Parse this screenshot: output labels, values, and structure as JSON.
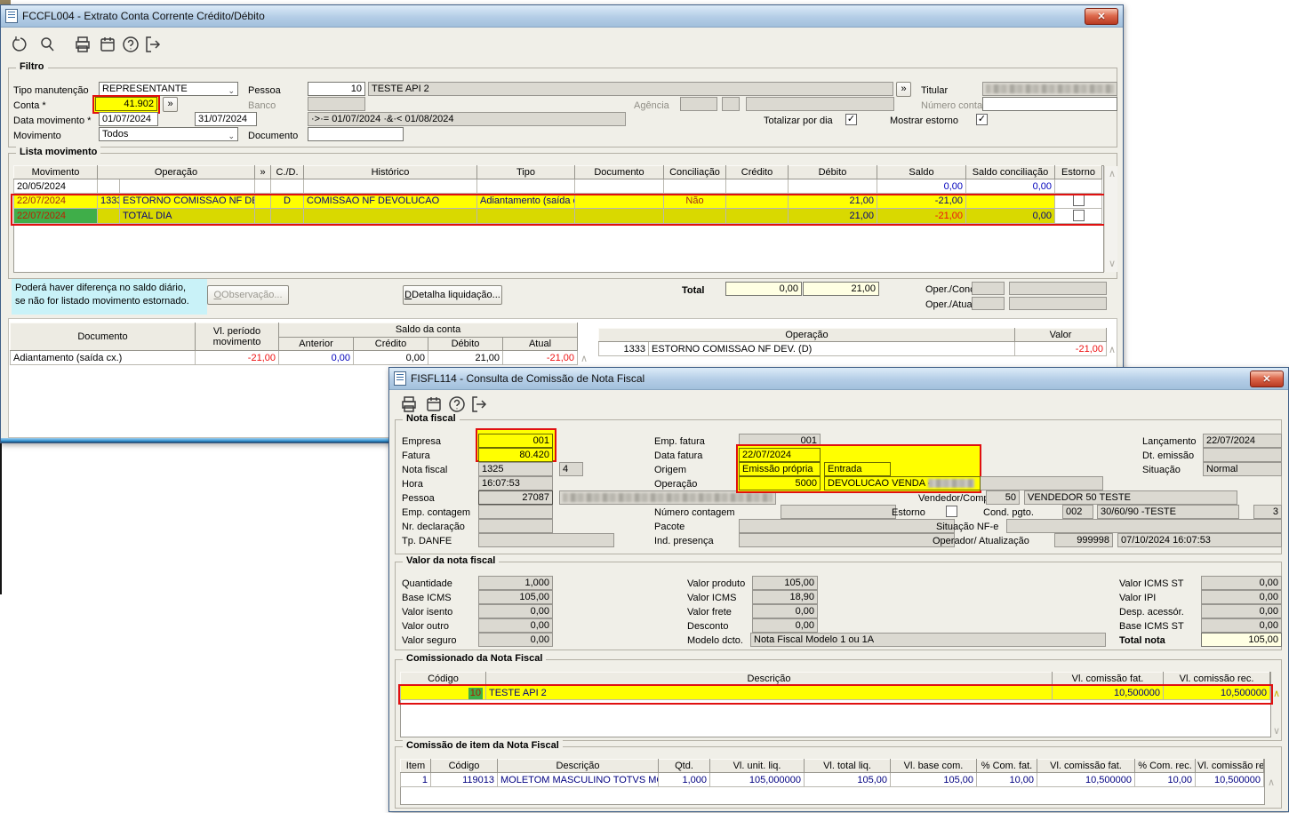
{
  "w1": {
    "title": "FCCFL004 - Extrato Conta Corrente Crédito/Débito",
    "toolbar_icons": [
      "undo-icon",
      "search-icon",
      "print-icon",
      "calendar-icon",
      "help-icon",
      "exit-icon"
    ],
    "filtro": {
      "legend": "Filtro",
      "tipo_label": "Tipo manutenção",
      "tipo_value": "REPRESENTANTE",
      "pessoa_label": "Pessoa",
      "pessoa_code": "10",
      "pessoa_name": "TESTE API 2",
      "expand": "»",
      "titular_label": "Titular",
      "conta_label": "Conta *",
      "conta_value": "41.902",
      "banco_label": "Banco",
      "agencia_label": "Agência",
      "numero_conta_label": "Número conta",
      "data_label": "Data movimento *",
      "data_de": "01/07/2024",
      "data_ate": "31/07/2024",
      "data_expr": "·>·= 01/07/2024 ·&·< 01/08/2024",
      "totalizar_label": "Totalizar por dia",
      "mostrar_label": "Mostrar estorno",
      "movimento_label": "Movimento",
      "movimento_value": "Todos",
      "documento_label": "Documento"
    },
    "lista": {
      "legend": "Lista movimento",
      "h": {
        "movimento": "Movimento",
        "operacao": "Operação",
        "expand": "»",
        "cd": "C./D.",
        "historico": "Histórico",
        "tipo": "Tipo",
        "documento": "Documento",
        "conciliacao": "Conciliação",
        "credito": "Crédito",
        "debito": "Débito",
        "saldo": "Saldo",
        "saldo_conc": "Saldo conciliação",
        "estorno": "Estorno"
      },
      "rows": [
        {
          "movimento": "20/05/2024",
          "saldo": "0,00",
          "saldo_conc": "0,00"
        },
        {
          "movimento": "22/07/2024",
          "code": "1333",
          "operacao": "ESTORNO COMISSAO NF DEV. (D)",
          "cd": "D",
          "historico": "COMISSAO NF DEVOLUCAO",
          "tipo": "Adiantamento (saída c",
          "conciliacao": "Não",
          "debito": "21,00",
          "saldo": "-21,00"
        },
        {
          "movimento": "22/07/2024",
          "operacao": "TOTAL DIA",
          "debito": "21,00",
          "saldo": "-21,00",
          "saldo_conc": "0,00"
        }
      ]
    },
    "note1": "Poderá haver diferença no saldo diário,",
    "note2": "se não for listado movimento estornado.",
    "observacao_button": "Observação...",
    "detalha_button": "Detalha liquidação...",
    "total_label": "Total",
    "total_credito": "0,00",
    "total_debito": "21,00",
    "oper_concil_label": "Oper./Concil.",
    "oper_atual_label": "Oper./Atual.",
    "doc_table": {
      "h_documento": "Documento",
      "h_periodo": "Vl. período movimento",
      "h_saldo": "Saldo da conta",
      "h_anterior": "Anterior",
      "h_credito": "Crédito",
      "h_debito": "Débito",
      "h_atual": "Atual",
      "documento": "Adiantamento (saída cx.)",
      "periodo": "-21,00",
      "anterior": "0,00",
      "credito": "0,00",
      "debito": "21,00",
      "atual": "-21,00"
    },
    "op_table": {
      "h_operacao": "Operação",
      "h_valor": "Valor",
      "code": "1333",
      "operacao": "ESTORNO COMISSAO NF DEV. (D)",
      "valor": "-21,00"
    }
  },
  "w2": {
    "title": "FISFL114 - Consulta de Comissão de Nota Fiscal",
    "toolbar_icons": [
      "print-icon",
      "calendar-icon",
      "help-icon",
      "exit-icon"
    ],
    "nf": {
      "legend": "Nota fiscal",
      "empresa_label": "Empresa",
      "empresa": "001",
      "fatura_label": "Fatura",
      "fatura": "80.420",
      "nota_label": "Nota fiscal",
      "nota": "1325",
      "serie": "4",
      "hora_label": "Hora",
      "hora": "16:07:53",
      "pessoa_label": "Pessoa",
      "pessoa": "27087",
      "emp_contagem_label": "Emp. contagem",
      "nr_declaracao_label": "Nr. declaração",
      "tp_danfe_label": "Tp. DANFE",
      "emp_fatura_label": "Emp. fatura",
      "emp_fatura": "001",
      "data_fatura_label": "Data fatura",
      "data_fatura": "22/07/2024",
      "origem_label": "Origem",
      "origem1": "Emissão própria",
      "origem2": "Entrada",
      "operacao_label": "Operação",
      "operacao_code": "5000",
      "operacao_desc": "DEVOLUCAO VENDA - ",
      "numero_contagem_label": "Número contagem",
      "pacote_label": "Pacote",
      "ind_presenca_label": "Ind. presença",
      "vendedor_label": "Vendedor/Compr.",
      "vendedor_code": "50",
      "vendedor_name": "VENDEDOR 50 TESTE",
      "estorno_label": "Estorno",
      "cond_label": "Cond. pgto.",
      "cond_code": "002",
      "cond_name": "30/60/90 -TESTE",
      "cond_parc": "3",
      "situacao_nfe_label": "Situação NF-e",
      "operador_label": "Operador/ Atualização",
      "operador_code": "999998",
      "operador_dt": "07/10/2024 16:07:53",
      "lancamento_label": "Lançamento",
      "lancamento": "22/07/2024",
      "dt_emissao_label": "Dt. emissão",
      "situacao_label": "Situação",
      "situacao": "Normal"
    },
    "valor": {
      "legend": "Valor da nota fiscal",
      "quantidade_label": "Quantidade",
      "quantidade": "1,000",
      "base_icms_label": "Base ICMS",
      "base_icms": "105,00",
      "isento_label": "Valor isento",
      "isento": "0,00",
      "outro_label": "Valor outro",
      "outro": "0,00",
      "seguro_label": "Valor seguro",
      "seguro": "0,00",
      "produto_label": "Valor produto",
      "produto": "105,00",
      "icms_label": "Valor ICMS",
      "icms": "18,90",
      "frete_label": "Valor frete",
      "frete": "0,00",
      "desconto_label": "Desconto",
      "desconto": "0,00",
      "modelo_label": "Modelo dcto.",
      "modelo": "Nota Fiscal Modelo 1 ou 1A",
      "icms_st_label": "Valor ICMS ST",
      "icms_st": "0,00",
      "ipi_label": "Valor IPI",
      "ipi": "0,00",
      "desp_label": "Desp. acessór.",
      "desp": "0,00",
      "base_st_label": "Base ICMS ST",
      "base_st": "0,00",
      "total_label": "Total nota",
      "total": "105,00"
    },
    "comissionado": {
      "legend": "Comissionado da Nota Fiscal",
      "h_codigo": "Código",
      "h_descricao": "Descrição",
      "h_fat": "Vl. comissão fat.",
      "h_rec": "Vl. comissão rec.",
      "codigo": "10",
      "descricao": "TESTE API 2",
      "fat": "10,500000",
      "rec": "10,500000"
    },
    "item": {
      "legend": "Comissão de item da Nota Fiscal",
      "h": {
        "item": "Item",
        "codigo": "Código",
        "descricao": "Descrição",
        "qtd": "Qtd.",
        "unit": "Vl. unit. liq.",
        "total": "Vl. total liq.",
        "base": "Vl. base com.",
        "pfat": "% Com. fat.",
        "comfat": "Vl. comissão fat.",
        "prec": "% Com. rec.",
        "comrec": "Vl. comissão rec."
      },
      "row": {
        "item": "1",
        "codigo": "119013",
        "descricao": "MOLETOM MASCULINO TOTVS MODA",
        "qtd": "1,000",
        "unit": "105,000000",
        "total": "105,00",
        "base": "105,00",
        "pfat": "10,00",
        "comfat": "10,500000",
        "prec": "10,00",
        "comrec": "10,500000"
      }
    }
  }
}
